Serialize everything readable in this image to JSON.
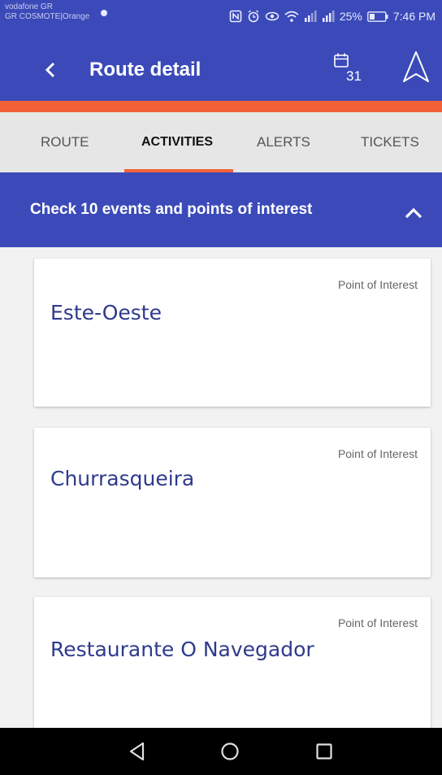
{
  "status_bar": {
    "carrier_line1": "vodafone GR",
    "carrier_line2": "GR COSMOTE|Orange",
    "battery": "25%",
    "time": "7:46 PM"
  },
  "appbar": {
    "title": "Route detail",
    "calendar_day": "31"
  },
  "tabs": [
    {
      "label": "ROUTE",
      "active": false
    },
    {
      "label": "ACTIVITIES",
      "active": true
    },
    {
      "label": "ALERTS",
      "active": false
    },
    {
      "label": "TICKETS",
      "active": false
    }
  ],
  "events_header": {
    "title": "Check 10 events and points of interest"
  },
  "cards": [
    {
      "type": "Point of Interest",
      "name": "Este-Oeste"
    },
    {
      "type": "Point of Interest",
      "name": "Churrasqueira"
    },
    {
      "type": "Point of Interest",
      "name": "Restaurante O Navegador"
    }
  ],
  "colors": {
    "primary": "#3b4ab8",
    "accent": "#f26138",
    "tab_bar": "#e6e6e6",
    "card_title": "#2e3a8c"
  }
}
